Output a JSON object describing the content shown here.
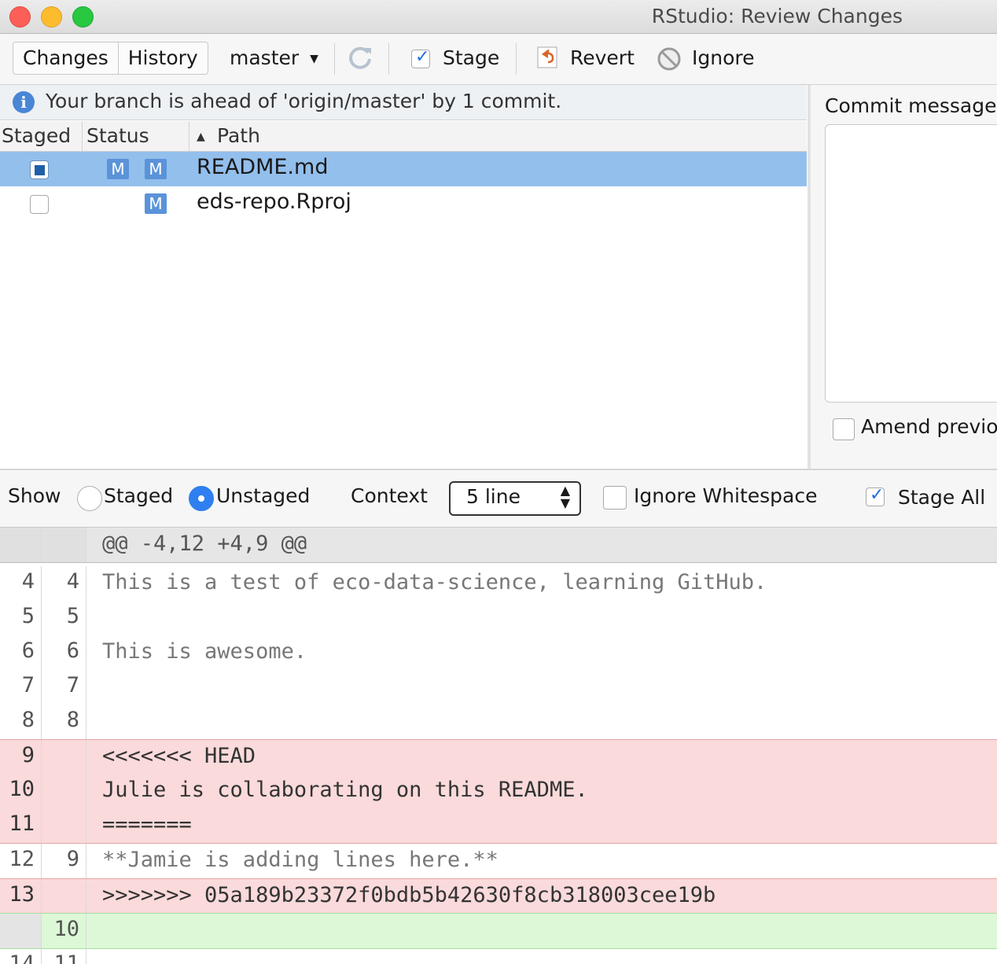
{
  "window": {
    "title": "RStudio: Review Changes"
  },
  "toolbar": {
    "tabs": [
      "Changes",
      "History"
    ],
    "branch": "master",
    "stage_label": "Stage",
    "revert_label": "Revert",
    "ignore_label": "Ignore"
  },
  "info": {
    "text": "Your branch is ahead of 'origin/master' by 1 commit."
  },
  "files": {
    "headers": {
      "staged": "Staged",
      "status": "Status",
      "path": "Path"
    },
    "rows": [
      {
        "path": "README.md",
        "status_staged": "M",
        "status_unstaged": "M",
        "staged": "partial",
        "selected": true
      },
      {
        "path": "eds-repo.Rproj",
        "status_staged": "",
        "status_unstaged": "M",
        "staged": "unchecked",
        "selected": false
      }
    ]
  },
  "commit": {
    "label": "Commit message",
    "amend_label": "Amend previo"
  },
  "options": {
    "show_label": "Show",
    "staged_label": "Staged",
    "unstaged_label": "Unstaged",
    "selected_view": "Unstaged",
    "context_label": "Context",
    "context_value": "5 line",
    "ignore_ws_label": "Ignore Whitespace",
    "ignore_ws_checked": false,
    "stage_all_label": "Stage All",
    "stage_all_checked": true
  },
  "diff": {
    "hunk": "@@ -4,12 +4,9 @@",
    "lines": [
      {
        "old": "4",
        "new": "4",
        "text": "This is a test of eco-data-science, learning GitHub.",
        "type": "context"
      },
      {
        "old": "5",
        "new": "5",
        "text": "",
        "type": "context"
      },
      {
        "old": "6",
        "new": "6",
        "text": "This is awesome.",
        "type": "context"
      },
      {
        "old": "7",
        "new": "7",
        "text": "",
        "type": "context"
      },
      {
        "old": "8",
        "new": "8",
        "text": "",
        "type": "context"
      },
      {
        "old": "9",
        "new": "",
        "text": "<<<<<<< HEAD",
        "type": "del"
      },
      {
        "old": "10",
        "new": "",
        "text": "Julie is collaborating on this README.",
        "type": "del"
      },
      {
        "old": "11",
        "new": "",
        "text": "=======",
        "type": "del"
      },
      {
        "old": "12",
        "new": "9",
        "text": "**Jamie is adding lines here.**",
        "type": "context"
      },
      {
        "old": "13",
        "new": "",
        "text": ">>>>>>> 05a189b23372f0bdb5b42630f8cb318003cee19b",
        "type": "del"
      },
      {
        "old": "",
        "new": "10",
        "text": "",
        "type": "add"
      },
      {
        "old": "14",
        "new": "11",
        "text": "",
        "type": "context"
      }
    ]
  },
  "colors": {
    "selection": "#93bfec",
    "badge": "#5b93d9",
    "deleted_bg": "#fadada",
    "added_bg": "#dcf8d6",
    "radio_on": "#2f7ff0"
  },
  "icons": [
    "close-icon",
    "minimize-icon",
    "maximize-icon",
    "dropdown-caret-icon",
    "refresh-icon",
    "revert-icon",
    "ignore-icon",
    "info-icon",
    "sort-ascending-icon",
    "select-arrows-icon"
  ]
}
